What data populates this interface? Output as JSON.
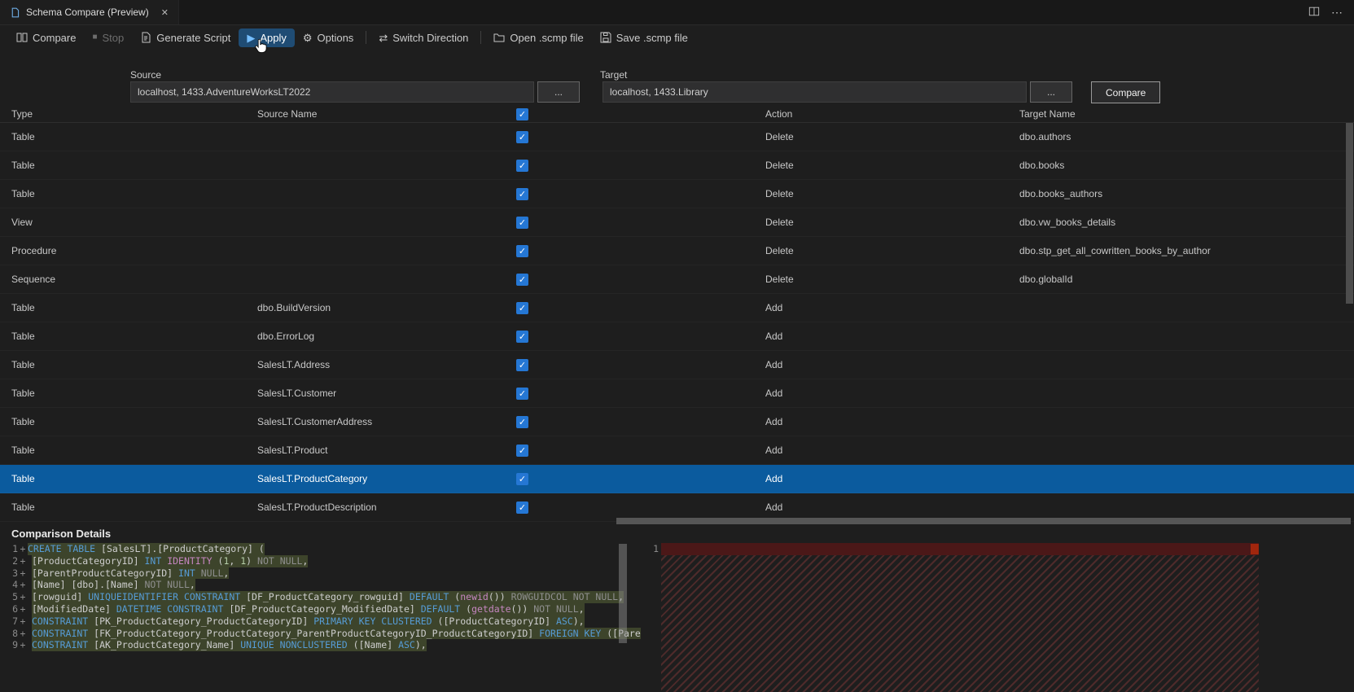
{
  "colors": {
    "selection_blue": "#0b5b9e",
    "checkbox_blue": "#2577d4",
    "apply_highlight": "#1f4c74",
    "diff_added_green": "#39441f",
    "diff_removed_red": "#4b1818",
    "diff_removed_marker": "#a1260d"
  },
  "tab": {
    "title": "Schema Compare (Preview)"
  },
  "toolbar": {
    "items": [
      {
        "label": "Compare"
      },
      {
        "label": "Stop"
      },
      {
        "label": "Generate Script"
      },
      {
        "label": "Apply"
      },
      {
        "label": "Options"
      },
      {
        "label": "Switch Direction"
      },
      {
        "label": "Open .scmp file"
      },
      {
        "label": "Save .scmp file"
      }
    ]
  },
  "connections": {
    "source_label": "Source",
    "source_value": "localhost, 1433.AdventureWorksLT2022",
    "target_label": "Target",
    "target_value": "localhost, 1433.Library",
    "browse_label": "...",
    "compare_button_label": "Compare"
  },
  "grid": {
    "columns": [
      "Type",
      "Source Name",
      "Action",
      "Target Name"
    ],
    "rows": [
      {
        "type": "Table",
        "source": "",
        "checked": true,
        "action": "Delete",
        "target": "dbo.authors",
        "selected": false
      },
      {
        "type": "Table",
        "source": "",
        "checked": true,
        "action": "Delete",
        "target": "dbo.books",
        "selected": false
      },
      {
        "type": "Table",
        "source": "",
        "checked": true,
        "action": "Delete",
        "target": "dbo.books_authors",
        "selected": false
      },
      {
        "type": "View",
        "source": "",
        "checked": true,
        "action": "Delete",
        "target": "dbo.vw_books_details",
        "selected": false
      },
      {
        "type": "Procedure",
        "source": "",
        "checked": true,
        "action": "Delete",
        "target": "dbo.stp_get_all_cowritten_books_by_author",
        "selected": false
      },
      {
        "type": "Sequence",
        "source": "",
        "checked": true,
        "action": "Delete",
        "target": "dbo.globalId",
        "selected": false
      },
      {
        "type": "Table",
        "source": "dbo.BuildVersion",
        "checked": true,
        "action": "Add",
        "target": "",
        "selected": false
      },
      {
        "type": "Table",
        "source": "dbo.ErrorLog",
        "checked": true,
        "action": "Add",
        "target": "",
        "selected": false
      },
      {
        "type": "Table",
        "source": "SalesLT.Address",
        "checked": true,
        "action": "Add",
        "target": "",
        "selected": false
      },
      {
        "type": "Table",
        "source": "SalesLT.Customer",
        "checked": true,
        "action": "Add",
        "target": "",
        "selected": false
      },
      {
        "type": "Table",
        "source": "SalesLT.CustomerAddress",
        "checked": true,
        "action": "Add",
        "target": "",
        "selected": false
      },
      {
        "type": "Table",
        "source": "SalesLT.Product",
        "checked": true,
        "action": "Add",
        "target": "",
        "selected": false
      },
      {
        "type": "Table",
        "source": "SalesLT.ProductCategory",
        "checked": true,
        "action": "Add",
        "target": "",
        "selected": true
      },
      {
        "type": "Table",
        "source": "SalesLT.ProductDescription",
        "checked": true,
        "action": "Add",
        "target": "",
        "selected": false
      }
    ]
  },
  "details": {
    "title": "Comparison Details"
  },
  "diff": {
    "right_first_line_num": "1",
    "left_lines": [
      {
        "num": "1",
        "sign": "+",
        "indent": false,
        "tokens": [
          {
            "c": "kw",
            "t": "CREATE TABLE"
          },
          {
            "c": "id",
            "t": " [SalesLT].[ProductCategory] ("
          }
        ]
      },
      {
        "num": "2",
        "sign": "+",
        "indent": true,
        "tokens": [
          {
            "c": "id",
            "t": "[ProductCategoryID] "
          },
          {
            "c": "kw",
            "t": "INT"
          },
          {
            "c": "fn",
            "t": " IDENTITY"
          },
          {
            "c": "id",
            "t": " ("
          },
          {
            "c": "num",
            "t": "1"
          },
          {
            "c": "id",
            "t": ", "
          },
          {
            "c": "num",
            "t": "1"
          },
          {
            "c": "id",
            "t": ") "
          },
          {
            "c": "dim",
            "t": "NOT NULL"
          },
          {
            "c": "id",
            "t": ","
          }
        ]
      },
      {
        "num": "3",
        "sign": "+",
        "indent": true,
        "tokens": [
          {
            "c": "id",
            "t": "[ParentProductCategoryID] "
          },
          {
            "c": "kw",
            "t": "INT"
          },
          {
            "c": "dim",
            "t": " NULL"
          },
          {
            "c": "id",
            "t": ","
          }
        ]
      },
      {
        "num": "4",
        "sign": "+",
        "indent": true,
        "tokens": [
          {
            "c": "id",
            "t": "[Name] [dbo].[Name] "
          },
          {
            "c": "dim",
            "t": "NOT NULL"
          },
          {
            "c": "id",
            "t": ","
          }
        ]
      },
      {
        "num": "5",
        "sign": "+",
        "indent": true,
        "tokens": [
          {
            "c": "id",
            "t": "[rowguid] "
          },
          {
            "c": "kw",
            "t": "UNIQUEIDENTIFIER CONSTRAINT"
          },
          {
            "c": "id",
            "t": " [DF_ProductCategory_rowguid] "
          },
          {
            "c": "kw",
            "t": "DEFAULT"
          },
          {
            "c": "id",
            "t": " ("
          },
          {
            "c": "fn",
            "t": "newid"
          },
          {
            "c": "id",
            "t": "()) "
          },
          {
            "c": "dim",
            "t": "ROWGUIDCOL NOT NULL"
          },
          {
            "c": "id",
            "t": ","
          }
        ]
      },
      {
        "num": "6",
        "sign": "+",
        "indent": true,
        "tokens": [
          {
            "c": "id",
            "t": "[ModifiedDate] "
          },
          {
            "c": "kw",
            "t": "DATETIME CONSTRAINT"
          },
          {
            "c": "id",
            "t": " [DF_ProductCategory_ModifiedDate] "
          },
          {
            "c": "kw",
            "t": "DEFAULT"
          },
          {
            "c": "id",
            "t": " ("
          },
          {
            "c": "fn",
            "t": "getdate"
          },
          {
            "c": "id",
            "t": "()) "
          },
          {
            "c": "dim",
            "t": "NOT NULL"
          },
          {
            "c": "id",
            "t": ","
          }
        ]
      },
      {
        "num": "7",
        "sign": "+",
        "indent": true,
        "tokens": [
          {
            "c": "kw",
            "t": "CONSTRAINT"
          },
          {
            "c": "id",
            "t": " [PK_ProductCategory_ProductCategoryID] "
          },
          {
            "c": "kw",
            "t": "PRIMARY KEY CLUSTERED"
          },
          {
            "c": "id",
            "t": " ([ProductCategoryID] "
          },
          {
            "c": "kw",
            "t": "ASC"
          },
          {
            "c": "id",
            "t": "),"
          }
        ]
      },
      {
        "num": "8",
        "sign": "+",
        "indent": true,
        "tokens": [
          {
            "c": "kw",
            "t": "CONSTRAINT"
          },
          {
            "c": "id",
            "t": " [FK_ProductCategory_ProductCategory_ParentProductCategoryID_ProductCategoryID] "
          },
          {
            "c": "kw",
            "t": "FOREIGN KEY"
          },
          {
            "c": "id",
            "t": " ([ParentProductCatego"
          }
        ]
      },
      {
        "num": "9",
        "sign": "+",
        "indent": true,
        "tokens": [
          {
            "c": "kw",
            "t": "CONSTRAINT"
          },
          {
            "c": "id",
            "t": " [AK_ProductCategory_Name] "
          },
          {
            "c": "kw",
            "t": "UNIQUE NONCLUSTERED"
          },
          {
            "c": "id",
            "t": " ([Name] "
          },
          {
            "c": "kw",
            "t": "ASC"
          },
          {
            "c": "id",
            "t": "),"
          }
        ]
      }
    ]
  },
  "glyphs": {
    "check": "✓",
    "close": "✕",
    "more": "⋯",
    "stop": "■",
    "play": "▶",
    "gear": "⚙",
    "switch": "⇄"
  }
}
